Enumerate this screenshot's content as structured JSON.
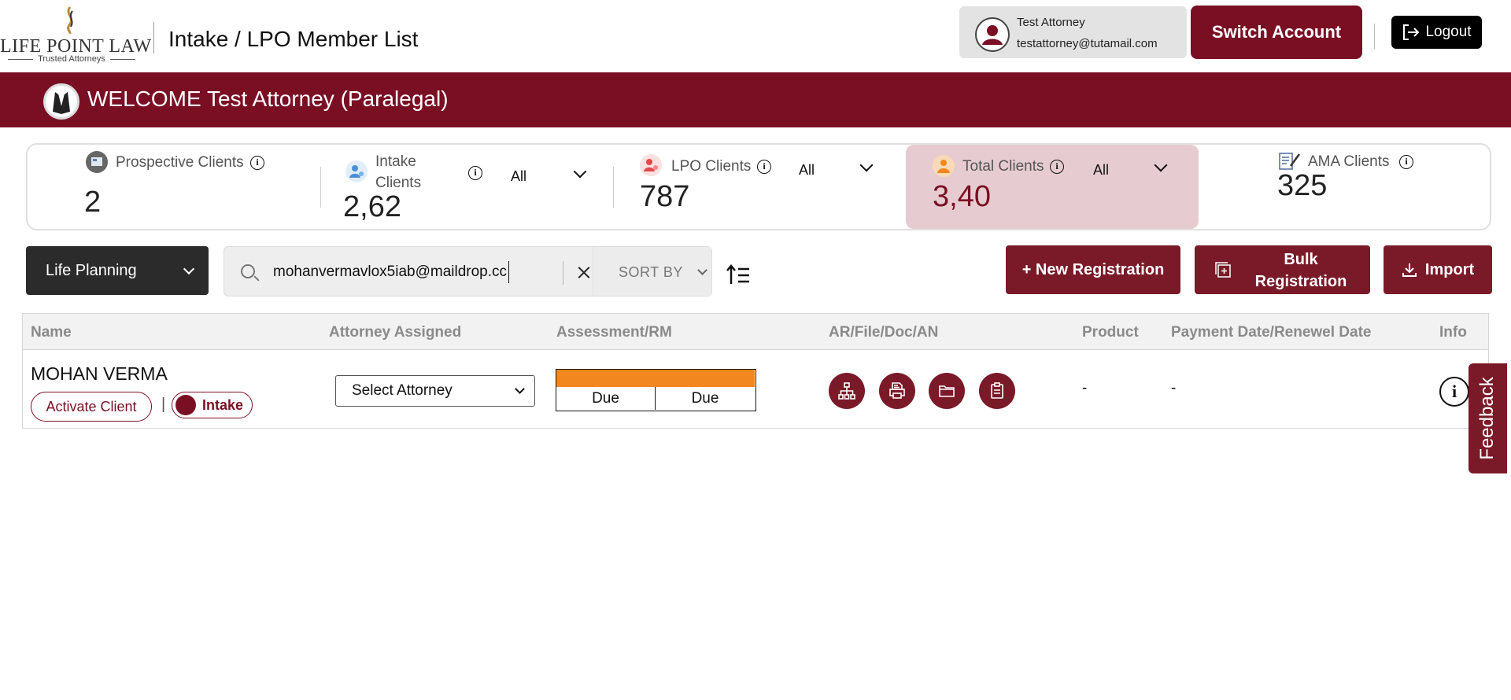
{
  "header": {
    "logo_name": "LIFE POINT LAW",
    "logo_tagline": "Trusted Attorneys",
    "page_title": "Intake / LPO Member List",
    "user_name": "Test Attorney",
    "user_email": "testattorney@tutamail.com",
    "switch_account_label": "Switch Account",
    "logout_label": "Logout"
  },
  "welcome": {
    "text": "WELCOME Test Attorney (Paralegal)"
  },
  "stats": {
    "prospective": {
      "label": "Prospective Clients",
      "value": "2"
    },
    "intake": {
      "label_line1": "Intake",
      "label_line2": "Clients",
      "value": "2,62",
      "filter": "All"
    },
    "lpo": {
      "label": "LPO Clients",
      "value": "787",
      "filter": "All"
    },
    "total": {
      "label": "Total Clients",
      "value": "3,40",
      "filter": "All"
    },
    "ama": {
      "label": "AMA Clients",
      "value": "325"
    },
    "info_glyph": "i"
  },
  "toolbar": {
    "plan_select": "Life Planning",
    "search_value": "mohanvermavlox5iab@maildrop.cc",
    "sort_by_label": "SORT BY",
    "new_registration_label": "+ New Registration",
    "bulk_registration_line1": "Bulk",
    "bulk_registration_line2": "Registration",
    "import_label": "Import"
  },
  "table": {
    "columns": [
      "Name",
      "Attorney Assigned",
      "Assessment/RM",
      "AR/File/Doc/AN",
      "Product",
      "Payment Date/Renewel Date",
      "Info"
    ],
    "rows": [
      {
        "name": "MOHAN VERMA",
        "activate_label": "Activate Client",
        "separator": "|",
        "status_label": "Intake",
        "attorney_select": "Select Attorney",
        "assessment": "Due",
        "rm": "Due",
        "assessment_bar_color": "#f2871f",
        "doc_icons": [
          "org-chart-icon",
          "file-print-icon",
          "folder-icon",
          "clipboard-icon"
        ],
        "product": "-",
        "payment_date": "-"
      }
    ]
  },
  "feedback_label": "Feedback",
  "colors": {
    "brand": "#7a0f24",
    "button": "#7a1a28",
    "highlight": "#e6ccd0"
  }
}
